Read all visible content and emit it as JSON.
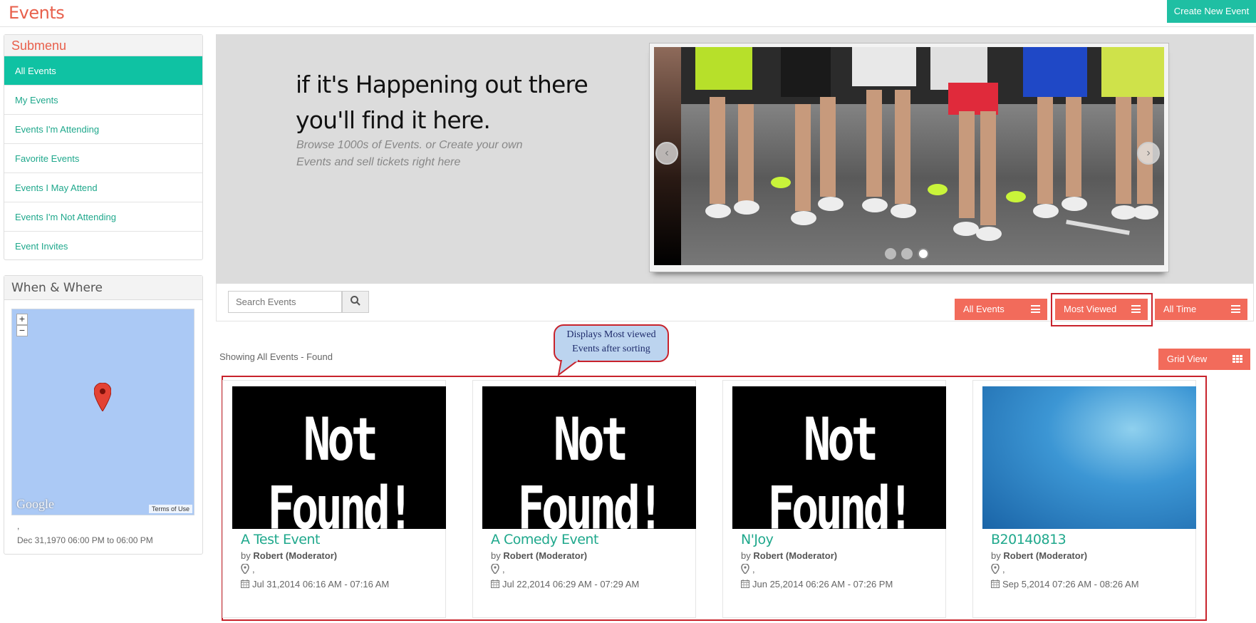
{
  "header": {
    "title": "Events",
    "create_label": "Create New Event"
  },
  "submenu": {
    "title": "Submenu",
    "items": [
      {
        "label": "All Events",
        "active": true
      },
      {
        "label": "My Events"
      },
      {
        "label": "Events I'm Attending"
      },
      {
        "label": "Favorite Events"
      },
      {
        "label": "Events I May Attend"
      },
      {
        "label": "Events I'm Not Attending"
      },
      {
        "label": "Event Invites"
      }
    ]
  },
  "when_where": {
    "title": "When & Where",
    "map_logo": "Google",
    "map_terms": "Terms of Use",
    "location": ",",
    "dates": "Dec 31,1970 06:00 PM to 06:00 PM"
  },
  "hero": {
    "headline": "if it's Happening out there you'll find it here.",
    "subtitle": "Browse 1000s of Events. or Create your own Events and sell tickets right here"
  },
  "toolbar": {
    "search_placeholder": "Search Events",
    "filters": [
      {
        "label": "All Events"
      },
      {
        "label": "Most Viewed",
        "highlighted": true
      },
      {
        "label": "All Time"
      }
    ]
  },
  "callout": {
    "text": "Displays Most viewed Events after sorting"
  },
  "listing": {
    "summary": "Showing All Events - Found",
    "view_label": "Grid View"
  },
  "events": [
    {
      "title": "A Test Event",
      "by_prefix": "by",
      "organizer": "Robert (Moderator)",
      "location": ",",
      "date": "Jul 31,2014 06:16 AM - 07:16 AM",
      "image": "Not Found!"
    },
    {
      "title": "A Comedy Event",
      "by_prefix": "by",
      "organizer": "Robert (Moderator)",
      "location": ",",
      "date": "Jul 22,2014 06:29 AM - 07:29 AM",
      "image": "Not Found!"
    },
    {
      "title": "N'Joy",
      "by_prefix": "by",
      "organizer": "Robert (Moderator)",
      "location": ",",
      "date": "Jun 25,2014 06:26 AM - 07:26 PM",
      "image": "Not Found!"
    },
    {
      "title": "B20140813",
      "by_prefix": "by",
      "organizer": "Robert (Moderator)",
      "location": ",",
      "date": "Sep 5,2014 07:26 AM - 08:26 AM",
      "image": ""
    }
  ],
  "colors": {
    "accent": "#1fbfa3",
    "brand": "#e8604c",
    "button": "#f26b5b",
    "highlight": "#c8232c"
  }
}
